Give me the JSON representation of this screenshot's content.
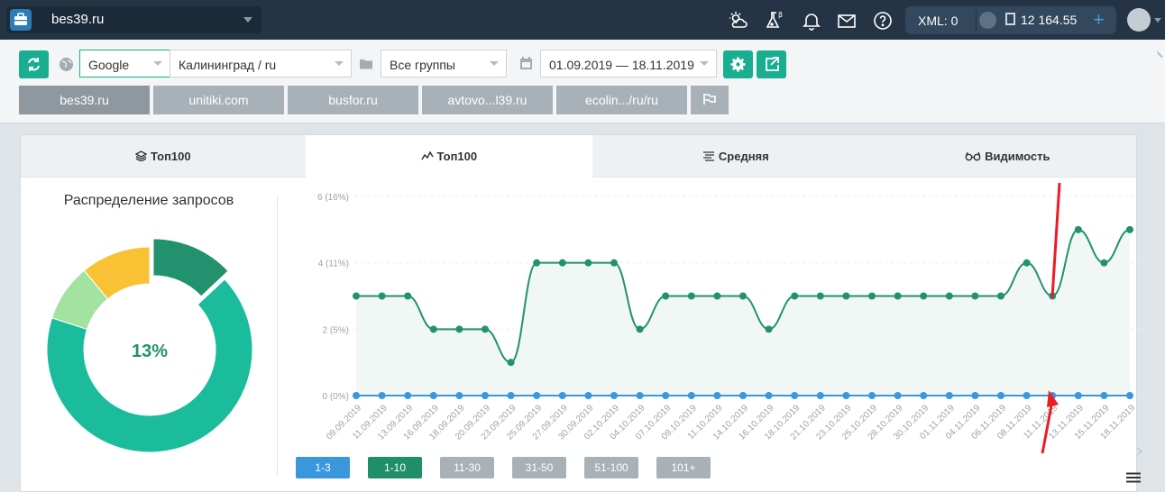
{
  "topbar": {
    "project": "bes39.ru",
    "icons": [
      "briefcase-icon",
      "weather-icon",
      "flask-beta-icon",
      "bell-icon",
      "mail-icon",
      "help-icon"
    ],
    "xml": "XML: 0",
    "balance": "12 164.55",
    "plus": "+"
  },
  "toolbar": {
    "search_engine": "Google",
    "region": "Калининград / ru",
    "group": "Все группы",
    "date_range": "01.09.2019 — 18.11.2019"
  },
  "sites": [
    {
      "label": "bes39.ru",
      "active": true
    },
    {
      "label": "unitiki.com"
    },
    {
      "label": "busfor.ru"
    },
    {
      "label": "avtovo...l39.ru"
    },
    {
      "label": "ecolin.../ru/ru"
    }
  ],
  "content_tabs": [
    {
      "label": "Топ100",
      "icon": "layers-icon"
    },
    {
      "label": "Топ100",
      "icon": "line-chart-icon",
      "active": true
    },
    {
      "label": "Средняя",
      "icon": "lines-icon"
    },
    {
      "label": "Видимость",
      "icon": "glasses-icon"
    }
  ],
  "donut": {
    "title": "Распределение запросов",
    "center_label": "13%"
  },
  "range_buttons": [
    {
      "label": "1-3",
      "color": "#3b97dc"
    },
    {
      "label": "1-10",
      "color": "#1f8f6a"
    },
    {
      "label": "11-30",
      "color": "#a9b1b8"
    },
    {
      "label": "31-50",
      "color": "#a9b1b8"
    },
    {
      "label": "51-100",
      "color": "#a9b1b8"
    },
    {
      "label": "101+",
      "color": "#a9b1b8"
    }
  ],
  "chart_data": [
    {
      "type": "pie",
      "labels": [
        "1-3",
        "1-10",
        "11-30",
        "31-50",
        "51-100",
        "101+"
      ],
      "values": [
        0,
        13,
        11,
        9,
        67,
        0
      ],
      "colors": [
        "#3b97dc",
        "#21926d",
        "#f9c234",
        "#a3e3a0",
        "#1bbc9b",
        "#a9b1b8"
      ],
      "center_label": "13%"
    },
    {
      "type": "line",
      "x": [
        "09.09.2019",
        "11.09.2019",
        "13.09.2019",
        "16.09.2019",
        "18.09.2019",
        "20.09.2019",
        "23.09.2019",
        "25.09.2019",
        "27.09.2019",
        "30.09.2019",
        "02.10.2019",
        "04.10.2019",
        "07.10.2019",
        "09.10.2019",
        "11.10.2019",
        "14.10.2019",
        "16.10.2019",
        "18.10.2019",
        "21.10.2019",
        "23.10.2019",
        "25.10.2019",
        "28.10.2019",
        "30.10.2019",
        "01.11.2019",
        "04.11.2019",
        "06.11.2019",
        "08.11.2019",
        "11.11.2019",
        "13.11.2019",
        "15.11.2019",
        "18.11.2019"
      ],
      "yticks": [
        "0 (0%)",
        "2 (5%)",
        "4 (11%)",
        "6 (16%)"
      ],
      "ylim": [
        0,
        6
      ],
      "series": [
        {
          "name": "1-10",
          "color": "#21926d",
          "values": [
            3,
            3,
            3,
            2,
            2,
            2,
            1,
            4,
            4,
            4,
            4,
            2,
            3,
            3,
            3,
            3,
            2,
            3,
            3,
            3,
            3,
            3,
            3,
            3,
            3,
            3,
            4,
            3,
            5,
            4,
            5
          ]
        },
        {
          "name": "1-3",
          "color": "#3b97dc",
          "values": [
            0,
            0,
            0,
            0,
            0,
            0,
            0,
            0,
            0,
            0,
            0,
            0,
            0,
            0,
            0,
            0,
            0,
            0,
            0,
            0,
            0,
            0,
            0,
            0,
            0,
            0,
            0,
            0,
            0,
            0,
            0
          ]
        }
      ]
    }
  ]
}
